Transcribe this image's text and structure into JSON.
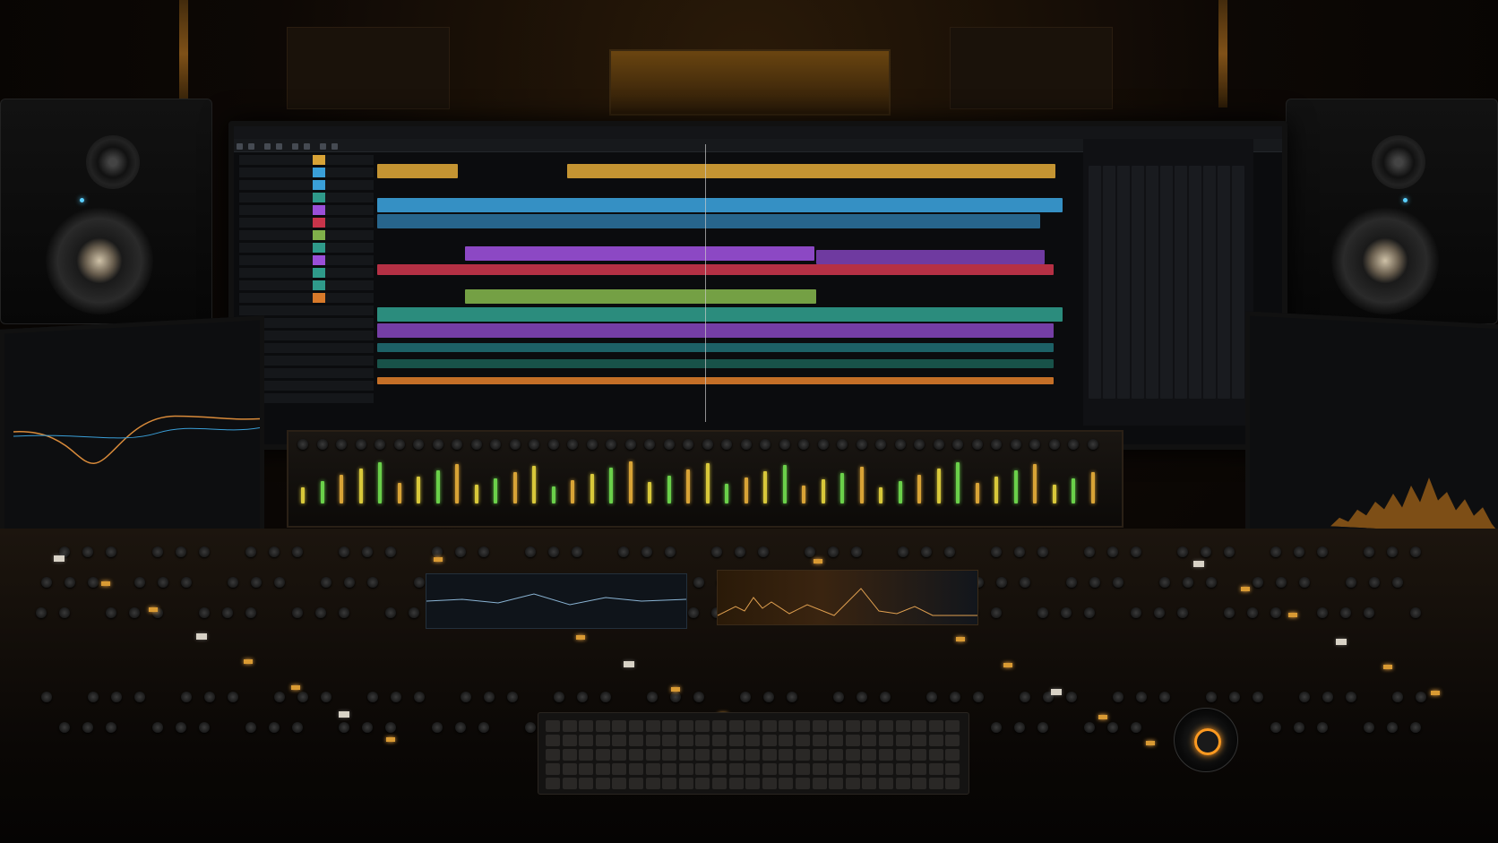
{
  "scene": {
    "description_tags": [
      "recording-studio",
      "mixing-console",
      "daw-monitor",
      "speakers",
      "tablets"
    ],
    "colors": {
      "amber": "#d99a33",
      "track_yellow": "#d8a336",
      "track_blue": "#3a9fd8",
      "track_purple": "#9a4fd8",
      "track_red": "#c8344a",
      "track_green": "#7fb04a",
      "track_teal": "#2f9a8a",
      "track_orange": "#d87a2a"
    },
    "daw": {
      "tracks": [
        {
          "color": "#d8a336"
        },
        {
          "color": "#3a9fd8"
        },
        {
          "color": "#3a9fd8"
        },
        {
          "color": "#2f9a8a"
        },
        {
          "color": "#9a4fd8"
        },
        {
          "color": "#c8344a"
        },
        {
          "color": "#7fb04a"
        },
        {
          "color": "#2f9a8a"
        },
        {
          "color": "#9a4fd8"
        },
        {
          "color": "#2f9a8a"
        },
        {
          "color": "#2f9a8a"
        },
        {
          "color": "#d87a2a"
        }
      ]
    }
  }
}
